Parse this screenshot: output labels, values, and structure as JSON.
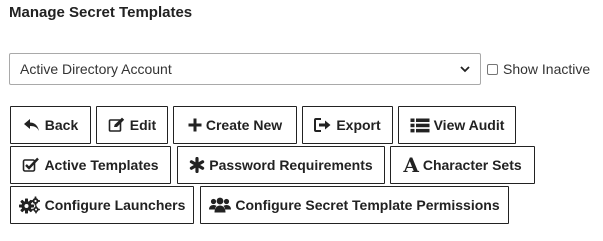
{
  "page": {
    "title": "Manage Secret Templates"
  },
  "template_select": {
    "selected": "Active Directory Account"
  },
  "show_inactive": {
    "label": "Show Inactive",
    "checked": false
  },
  "buttons": {
    "back": {
      "label": "Back",
      "icon": "back-arrow-icon"
    },
    "edit": {
      "label": "Edit",
      "icon": "edit-icon"
    },
    "create_new": {
      "label": "Create New",
      "icon": "plus-icon"
    },
    "export": {
      "label": "Export",
      "icon": "export-icon"
    },
    "view_audit": {
      "label": "View Audit",
      "icon": "list-icon"
    },
    "active_templates": {
      "label": "Active Templates",
      "icon": "checkbox-check-icon"
    },
    "password_requirements": {
      "label": "Password Requirements",
      "icon": "asterisk-icon"
    },
    "character_sets": {
      "label": "Character Sets",
      "icon": "font-icon"
    },
    "configure_launchers": {
      "label": "Configure Launchers",
      "icon": "gears-icon"
    },
    "configure_permissions": {
      "label": "Configure Secret Template Permissions",
      "icon": "users-icon"
    }
  }
}
